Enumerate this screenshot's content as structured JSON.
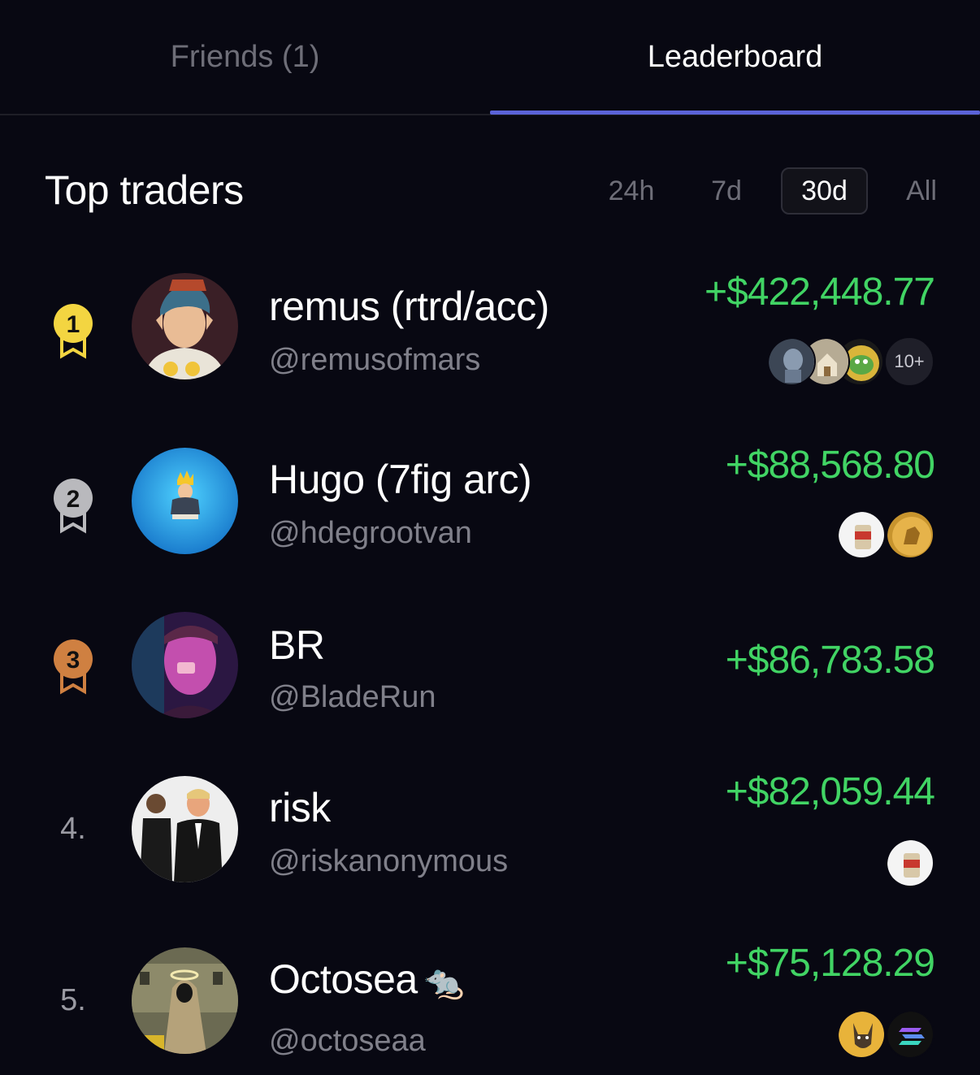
{
  "tabs": [
    {
      "label": "Friends (1)",
      "active": false
    },
    {
      "label": "Leaderboard",
      "active": true
    }
  ],
  "section": {
    "title": "Top traders",
    "ranges": [
      "24h",
      "7d",
      "30d",
      "All"
    ],
    "selected_range": "30d"
  },
  "accent": {
    "tab_underline": "#5b63d8",
    "profit": "#41d464",
    "gold": "#f3d541",
    "silver": "#b9b9bd",
    "bronze": "#cf8041"
  },
  "traders": [
    {
      "rank": "1",
      "medal": "gold",
      "name": "remus (rtrd/acc)",
      "handle": "@remusofmars",
      "pnl": "+$422,448.77",
      "tokens": [
        "robot-token",
        "house-token",
        "pepe-token"
      ],
      "more": "10+"
    },
    {
      "rank": "2",
      "medal": "silver",
      "name": "Hugo (7fig arc)",
      "handle": "@hdegrootvan",
      "pnl": "+$88,568.80",
      "tokens": [
        "can-token",
        "horse-token"
      ],
      "more": ""
    },
    {
      "rank": "3",
      "medal": "bronze",
      "name": "BR",
      "handle": "@BladeRun",
      "pnl": "+$86,783.58",
      "tokens": [],
      "more": ""
    },
    {
      "rank": "4.",
      "medal": "",
      "name": "risk",
      "handle": "@riskanonymous",
      "pnl": "+$82,059.44",
      "tokens": [
        "can-token"
      ],
      "more": ""
    },
    {
      "rank": "5.",
      "medal": "",
      "name": "Octosea",
      "name_emoji": "🐀",
      "handle": "@octoseaa",
      "pnl": "+$75,128.29",
      "tokens": [
        "dog-token",
        "solana-token"
      ],
      "more": ""
    }
  ]
}
